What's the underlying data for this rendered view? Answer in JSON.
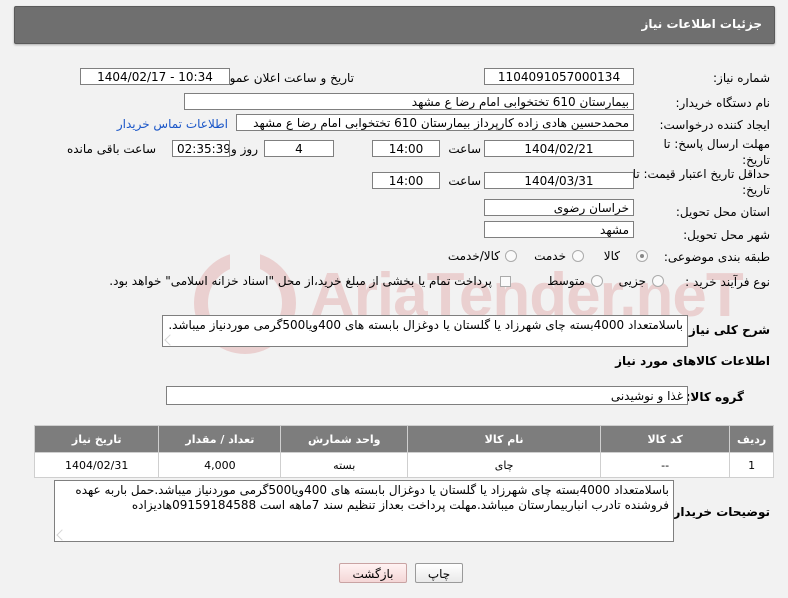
{
  "header": {
    "title": "جزئیات اطلاعات نیاز"
  },
  "form": {
    "need_number_label": "شماره نیاز:",
    "need_number": "1104091057000134",
    "announce_label": "تاریخ و ساعت اعلان عمومی:",
    "announce_value": "1404/02/17 - 10:34",
    "buyer_org_label": "نام دستگاه خریدار:",
    "buyer_org": "بیمارستان 610 تختخوابی امام رضا ع  مشهد",
    "requester_label": "ایجاد کننده درخواست:",
    "requester": "محمدحسین هادی زاده کارپرداز بیمارستان 610 تختخوابی امام رضا ع  مشهد",
    "contact_link": "اطلاعات تماس خریدار",
    "reply_deadline_label": "مهلت ارسال پاسخ: تا تاریخ:",
    "reply_date": "1404/02/21",
    "time_label": "ساعت",
    "reply_time": "14:00",
    "days_value": "4",
    "days_label": "روز و",
    "remaining_time": "02:35:39",
    "remaining_label": "ساعت باقی مانده",
    "price_validity_label": "حداقل تاریخ اعتبار قیمت: تا تاریخ:",
    "validity_date": "1404/03/31",
    "validity_time": "14:00",
    "province_label": "استان محل تحویل:",
    "province": "خراسان رضوی",
    "city_label": "شهر محل تحویل:",
    "city": "مشهد",
    "category_label": "طبقه بندی موضوعی:",
    "category_options": [
      "کالا",
      "خدمت",
      "کالا/خدمت"
    ],
    "category_selected": "کالا",
    "process_label": "نوع فرآیند خرید :",
    "process_options": [
      "جزیی",
      "متوسط"
    ],
    "payment_note": "پرداخت تمام یا بخشی از مبلغ خرید،از محل \"اسناد خزانه اسلامی\" خواهد بود."
  },
  "description": {
    "label": "شرح کلی نیاز:",
    "text": "باسلامتعداد 4000بسته چای شهرزاد یا گلستان یا دوغزال بابسته های 400ویا500گرمی موردنیاز میباشد."
  },
  "goods": {
    "section_title": "اطلاعات کالاهای مورد نیاز",
    "group_label": "گروه کالا:",
    "group_value": "غذا و نوشیدنی",
    "columns": [
      "ردیف",
      "کد کالا",
      "نام کالا",
      "واحد شمارش",
      "تعداد / مقدار",
      "تاریخ نیاز"
    ],
    "rows": [
      {
        "row": "1",
        "code": "--",
        "name": "چای",
        "unit": "بسته",
        "qty": "4,000",
        "date": "1404/02/31"
      }
    ]
  },
  "buyer_notes": {
    "label": "توضیحات خریدار:",
    "text": "باسلامتعداد 4000بسته چای شهرزاد یا گلستان یا دوغزال بابسته های 400ویا500گرمی موردنیاز میباشد.حمل باربه عهده فروشنده تادرب انباربیمارستان میباشد.مهلت پرداخت بعداز تنظیم سند 7ماهه است 09159184588هادیزاده"
  },
  "buttons": {
    "print": "چاپ",
    "back": "بازگشت"
  },
  "watermark": {
    "brand": "AriaTender.neT"
  },
  "colors": {
    "header_bg": "#6f6f6f",
    "table_header_bg": "#7d7d7d",
    "link": "#1a56c8",
    "watermark": "#c62828"
  }
}
